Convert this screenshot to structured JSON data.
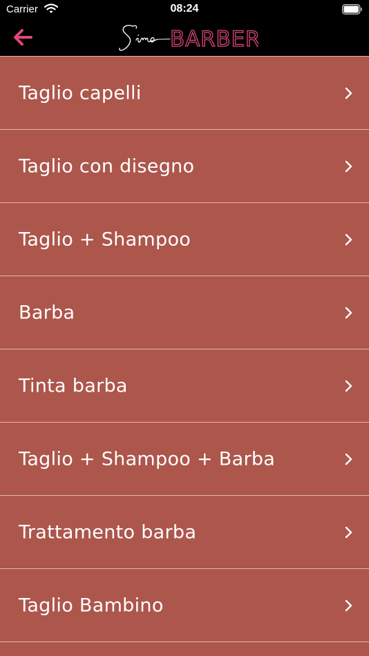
{
  "status_bar": {
    "carrier": "Carrier",
    "time": "08:24",
    "icons": [
      "wifi-icon",
      "battery-icon"
    ]
  },
  "nav_bar": {
    "back_icon": "arrow-left-icon",
    "logo": {
      "script_text": "Simo",
      "block_text": "BARBER"
    }
  },
  "menu": {
    "items": [
      {
        "label": "Taglio capelli"
      },
      {
        "label": "Taglio con disegno"
      },
      {
        "label": "Taglio + Shampoo"
      },
      {
        "label": "Barba"
      },
      {
        "label": "Tinta barba"
      },
      {
        "label": "Taglio + Shampoo + Barba"
      },
      {
        "label": "Trattamento barba"
      },
      {
        "label": "Taglio Bambino"
      }
    ],
    "row_icon": "chevron-right-icon"
  },
  "colors": {
    "background": "#ad564c",
    "bar": "#000000",
    "accent": "#e0477a",
    "divider": "#e6b6b0",
    "text": "#ffffff"
  }
}
